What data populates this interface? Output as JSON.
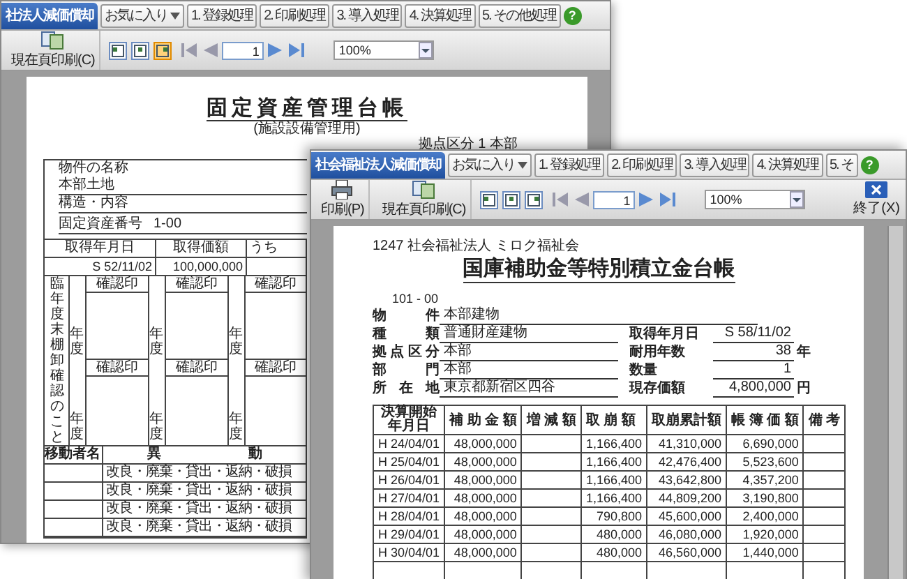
{
  "back_window": {
    "title_tab": "社法人減価償却",
    "menu": [
      {
        "kind": "dropdown",
        "label": "お気に入り"
      },
      {
        "kind": "button",
        "label": "1. 登録処理"
      },
      {
        "kind": "button",
        "label": "2. 印刷処理"
      },
      {
        "kind": "button",
        "label": "3. 導入処理"
      },
      {
        "kind": "button",
        "label": "4. 決算処理"
      },
      {
        "kind": "button",
        "label": "5. その他処理"
      }
    ],
    "help": "?",
    "toolbar": {
      "buttons": [
        {
          "kind": "page_print",
          "label": "現在頁印刷(C)"
        }
      ],
      "view_modes": [
        {
          "selected": false
        },
        {
          "selected": false
        },
        {
          "selected": true
        }
      ],
      "page": "1",
      "zoom": "100%"
    },
    "document": {
      "title": "固定資産管理台帳",
      "subtitle": "(施設設備管理用)",
      "division": "拠点区分 1 本部",
      "fields": [
        {
          "kind": "stacked",
          "label": "物件の名称",
          "value": "本部土地"
        },
        {
          "kind": "stacked",
          "label": "構造・内容"
        },
        {
          "kind": "inline",
          "label": "固定資産番号",
          "value": "1-00"
        }
      ],
      "acquisition": {
        "columns": [
          "取得年月日",
          "取得価額",
          "うち"
        ],
        "values": [
          "S 52/11/02",
          "100,000,000"
        ]
      },
      "inventory_note": "臨年度末棚卸確認のこと",
      "check_rows": [
        {
          "cells": [
            {
              "year": "年度",
              "stamp": "確認印"
            },
            {
              "year": "年度",
              "stamp": "確認印"
            },
            {
              "year": "年度",
              "stamp": "確認印"
            }
          ]
        },
        {
          "cells": [
            {
              "year": "年度",
              "stamp": "確認印"
            },
            {
              "year": "年度",
              "stamp": "確認印"
            },
            {
              "year": "年度",
              "stamp": "確認印"
            }
          ]
        }
      ],
      "movement": {
        "columns": [
          "移動者名",
          "異",
          "動"
        ],
        "rows": [
          "改良・廃棄・貸出・返納・破損",
          "改良・廃棄・貸出・返納・破損",
          "改良・廃棄・貸出・返納・破損",
          "改良・廃棄・貸出・返納・破損"
        ]
      }
    }
  },
  "front_window": {
    "title_tab": "社会福祉法人減価償却",
    "menu": [
      {
        "kind": "dropdown",
        "label": "お気に入り"
      },
      {
        "kind": "button",
        "label": "1. 登録処理"
      },
      {
        "kind": "button",
        "label": "2. 印刷処理"
      },
      {
        "kind": "button",
        "label": "3. 導入処理"
      },
      {
        "kind": "button",
        "label": "4. 決算処理"
      },
      {
        "kind": "button",
        "label": "5. そ"
      }
    ],
    "help": "?",
    "toolbar": {
      "buttons": [
        {
          "kind": "print",
          "label": "印刷(P)"
        },
        {
          "kind": "page_print",
          "label": "現在頁印刷(C)"
        }
      ],
      "view_modes": [
        {
          "selected": false
        },
        {
          "selected": false
        },
        {
          "selected": false
        }
      ],
      "page": "1",
      "zoom": "100%",
      "exit": "終了(X)"
    },
    "document": {
      "company": "1247 社会福祉法人 ミロク福祉会",
      "title": "国庫補助金等特別積立金台帳",
      "code": "101 - 00",
      "left_fields": [
        {
          "label": "物 件",
          "value": "本部建物"
        },
        {
          "label": "種 類",
          "value": "普通財産建物"
        },
        {
          "label": "拠点区分",
          "value": "本部"
        },
        {
          "label": "部 門",
          "value": "本部"
        },
        {
          "label": "所 在 地",
          "value": "東京都新宿区四谷"
        }
      ],
      "right_fields": [
        {
          "label": "取得年月日",
          "value": "S 58/11/02"
        },
        {
          "label": "耐用年数",
          "value": "38",
          "unit": "年"
        },
        {
          "label": "数量",
          "value": "1"
        },
        {
          "label": "現存価額",
          "value": "4,800,000",
          "unit": "円"
        }
      ],
      "table": {
        "columns": [
          "決算開始年月日",
          "補 助 金 額",
          "増 減 額",
          "取 崩 額",
          "取崩累計額",
          "帳 簿 価 額",
          "備 考"
        ],
        "rows": [
          [
            "H 24/04/01",
            "48,000,000",
            "",
            "1,166,400",
            "41,310,000",
            "6,690,000",
            ""
          ],
          [
            "H 25/04/01",
            "48,000,000",
            "",
            "1,166,400",
            "42,476,400",
            "5,523,600",
            ""
          ],
          [
            "H 26/04/01",
            "48,000,000",
            "",
            "1,166,400",
            "43,642,800",
            "4,357,200",
            ""
          ],
          [
            "H 27/04/01",
            "48,000,000",
            "",
            "1,166,400",
            "44,809,200",
            "3,190,800",
            ""
          ],
          [
            "H 28/04/01",
            "48,000,000",
            "",
            "790,800",
            "45,600,000",
            "2,400,000",
            ""
          ],
          [
            "H 29/04/01",
            "48,000,000",
            "",
            "480,000",
            "46,080,000",
            "1,920,000",
            ""
          ],
          [
            "H 30/04/01",
            "48,000,000",
            "",
            "480,000",
            "46,560,000",
            "1,440,000",
            ""
          ]
        ]
      }
    }
  }
}
